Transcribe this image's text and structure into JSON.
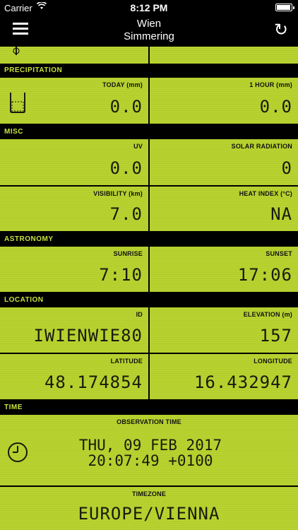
{
  "statusbar": {
    "carrier": "Carrier",
    "time": "8:12 PM"
  },
  "navbar": {
    "title_line1": "Wien",
    "title_line2": "Simmering"
  },
  "sections": {
    "precipitation": {
      "title": "PRECIPITATION",
      "today_label": "TODAY (mm)",
      "today_value": "0.0",
      "hour_label": "1 HOUR (mm)",
      "hour_value": "0.0"
    },
    "misc": {
      "title": "MISC",
      "uv_label": "UV",
      "uv_value": "0.0",
      "solar_label": "SOLAR RADIATION",
      "solar_value": "0",
      "visibility_label": "VISIBILITY (km)",
      "visibility_value": "7.0",
      "heat_label": "HEAT INDEX (°C)",
      "heat_value": "NA"
    },
    "astronomy": {
      "title": "ASTRONOMY",
      "sunrise_label": "SUNRISE",
      "sunrise_value": "7:10",
      "sunset_label": "SUNSET",
      "sunset_value": "17:06"
    },
    "location": {
      "title": "LOCATION",
      "id_label": "ID",
      "id_value": "IWIENWIE80",
      "elevation_label": "ELEVATION (m)",
      "elevation_value": "157",
      "lat_label": "LATITUDE",
      "lat_value": "48.174854",
      "lon_label": "LONGITUDE",
      "lon_value": "16.432947"
    },
    "time": {
      "title": "TIME",
      "obs_label": "OBSERVATION TIME",
      "obs_line1": "THU, 09 FEB 2017",
      "obs_line2": "20:07:49 +0100",
      "tz_label": "TIMEZONE",
      "tz_value": "EUROPE/VIENNA"
    }
  }
}
